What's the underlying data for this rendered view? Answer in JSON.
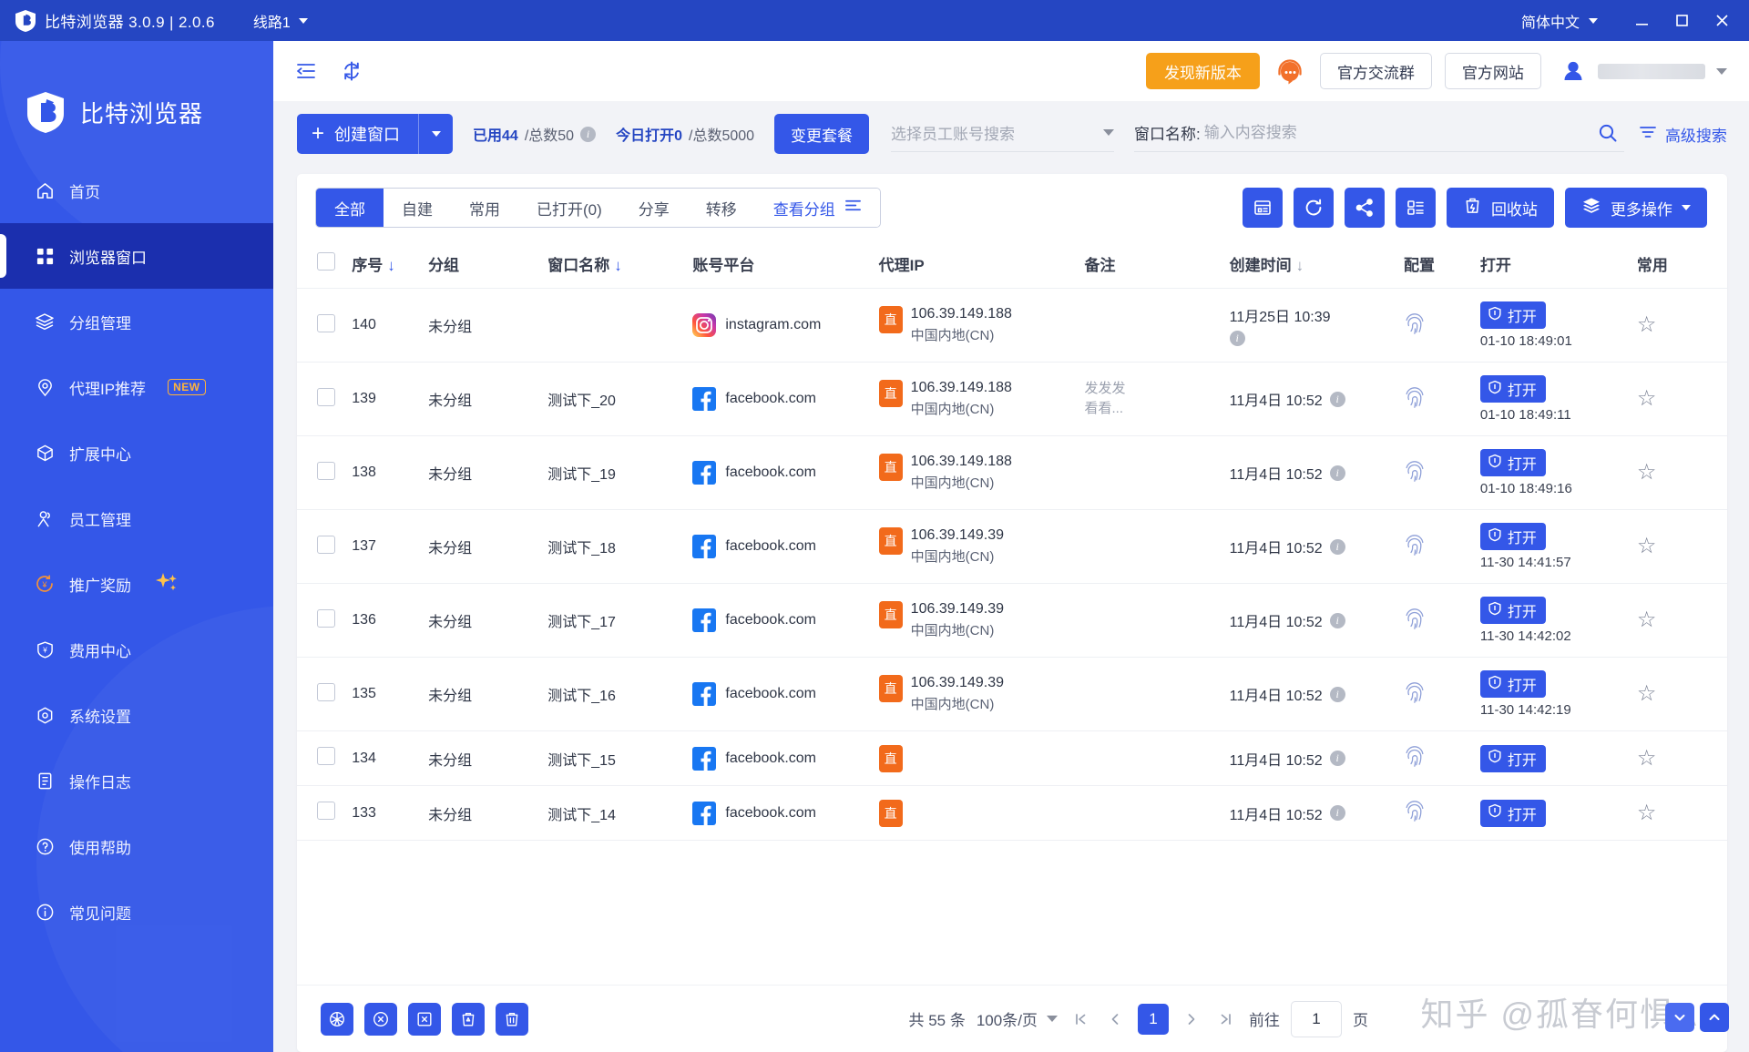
{
  "titlebar": {
    "logo_icon": "shield-b-logo-icon",
    "title": "比特浏览器 3.0.9 | 2.0.6",
    "line_label": "线路1",
    "language": "简体中文",
    "minimize": "_",
    "maximize": "❐",
    "close": "✕"
  },
  "sidebar": {
    "brand": "比特浏览器",
    "items": [
      {
        "label": "首页",
        "icon": "home-icon",
        "active": false
      },
      {
        "label": "浏览器窗口",
        "icon": "grid-windows-icon",
        "active": true
      },
      {
        "label": "分组管理",
        "icon": "layers-icon",
        "active": false
      },
      {
        "label": "代理IP推荐",
        "icon": "location-pin-icon",
        "active": false,
        "badge": "NEW"
      },
      {
        "label": "扩展中心",
        "icon": "cube-icon",
        "active": false
      },
      {
        "label": "员工管理",
        "icon": "user-group-icon",
        "active": false
      },
      {
        "label": "推广奖励",
        "icon": "coin-reward-icon",
        "active": false,
        "sparkle": "✦"
      },
      {
        "label": "费用中心",
        "icon": "shield-yuan-icon",
        "active": false
      },
      {
        "label": "系统设置",
        "icon": "settings-gear-icon",
        "active": false
      },
      {
        "label": "操作日志",
        "icon": "log-book-icon",
        "active": false
      },
      {
        "label": "使用帮助",
        "icon": "question-circle-icon",
        "active": false
      },
      {
        "label": "常见问题",
        "icon": "info-circle-icon",
        "active": false
      }
    ]
  },
  "topbar": {
    "collapse_icon": "collapse-sidebar-icon",
    "refresh_icon": "refresh-icon",
    "new_version_label": "发现新版本",
    "support_icon": "headset-support-icon",
    "official_group_label": "官方交流群",
    "official_site_label": "官方网站",
    "avatar_icon": "user-avatar-icon"
  },
  "actionbar": {
    "create_label": "创建窗口",
    "create_plus": "+",
    "quota_used_prefix": "已用",
    "quota_used": "44",
    "quota_total": "/总数50",
    "today_open_prefix": "今日打开",
    "today_open": "0",
    "today_total": "/总数5000",
    "change_plan_label": "变更套餐",
    "staff_select_placeholder": "选择员工账号搜索",
    "window_name_label": "窗口名称:",
    "window_name_placeholder": "输入内容搜索",
    "window_name_value": "",
    "search_icon": "search-icon",
    "advanced_search_label": "高级搜索"
  },
  "tabs": {
    "items": [
      {
        "label": "全部",
        "active": true
      },
      {
        "label": "自建",
        "active": false
      },
      {
        "label": "常用",
        "active": false
      },
      {
        "label": "已打开(0)",
        "active": false
      },
      {
        "label": "分享",
        "active": false
      },
      {
        "label": "转移",
        "active": false
      },
      {
        "label": "查看分组",
        "active": false,
        "icon": "filter-sort-icon"
      }
    ],
    "actions": [
      {
        "icon": "window-add-icon",
        "label": ""
      },
      {
        "icon": "refresh-circle-icon",
        "label": ""
      },
      {
        "icon": "share-nodes-icon",
        "label": ""
      },
      {
        "icon": "list-detail-icon",
        "label": ""
      },
      {
        "icon": "trash-recycle-icon",
        "label": "回收站"
      },
      {
        "icon": "layers-stack-icon",
        "label": "更多操作"
      }
    ]
  },
  "table": {
    "columns": [
      {
        "key": "chk",
        "label": "",
        "sort": false
      },
      {
        "key": "seq",
        "label": "序号",
        "sort": true,
        "sort_color": "blue"
      },
      {
        "key": "group",
        "label": "分组",
        "sort": false
      },
      {
        "key": "name",
        "label": "窗口名称",
        "sort": true,
        "sort_color": "blue"
      },
      {
        "key": "plat",
        "label": "账号平台",
        "sort": false
      },
      {
        "key": "ip",
        "label": "代理IP",
        "sort": false
      },
      {
        "key": "note",
        "label": "备注",
        "sort": false
      },
      {
        "key": "time",
        "label": "创建时间",
        "sort": true,
        "sort_color": "gray"
      },
      {
        "key": "cfg",
        "label": "配置",
        "sort": false
      },
      {
        "key": "open",
        "label": "打开",
        "sort": false
      },
      {
        "key": "star",
        "label": "常用",
        "sort": false
      }
    ],
    "sort_arrow": "↓",
    "group_default": "未分组",
    "open_label": "打开",
    "rows": [
      {
        "seq": "140",
        "group": "未分组",
        "name": "",
        "platform": "instagram.com",
        "platform_icon": "instagram-icon",
        "ip_tag": "直",
        "ip": "106.39.149.188",
        "ip_region": "中国内地(CN)",
        "note": "",
        "note2": "",
        "time": "11月25日 10:39",
        "time_info": true,
        "time_info_below": true,
        "config_icon": "fingerprint-icon",
        "open_time": "01-10 18:49:01",
        "star": "☆"
      },
      {
        "seq": "139",
        "group": "未分组",
        "name": "测试下_20",
        "platform": "facebook.com",
        "platform_icon": "facebook-icon",
        "ip_tag": "直",
        "ip": "106.39.149.188",
        "ip_region": "中国内地(CN)",
        "note": "发发发",
        "note2": "看看...",
        "time": "11月4日 10:52",
        "time_info": true,
        "time_info_below": false,
        "config_icon": "fingerprint-icon",
        "open_time": "01-10 18:49:11",
        "star": "☆"
      },
      {
        "seq": "138",
        "group": "未分组",
        "name": "测试下_19",
        "platform": "facebook.com",
        "platform_icon": "facebook-icon",
        "ip_tag": "直",
        "ip": "106.39.149.188",
        "ip_region": "中国内地(CN)",
        "note": "",
        "note2": "",
        "time": "11月4日 10:52",
        "time_info": true,
        "time_info_below": false,
        "config_icon": "fingerprint-icon",
        "open_time": "01-10 18:49:16",
        "star": "☆"
      },
      {
        "seq": "137",
        "group": "未分组",
        "name": "测试下_18",
        "platform": "facebook.com",
        "platform_icon": "facebook-icon",
        "ip_tag": "直",
        "ip": "106.39.149.39",
        "ip_region": "中国内地(CN)",
        "note": "",
        "note2": "",
        "time": "11月4日 10:52",
        "time_info": true,
        "time_info_below": false,
        "config_icon": "fingerprint-icon",
        "open_time": "11-30 14:41:57",
        "star": "☆"
      },
      {
        "seq": "136",
        "group": "未分组",
        "name": "测试下_17",
        "platform": "facebook.com",
        "platform_icon": "facebook-icon",
        "ip_tag": "直",
        "ip": "106.39.149.39",
        "ip_region": "中国内地(CN)",
        "note": "",
        "note2": "",
        "time": "11月4日 10:52",
        "time_info": true,
        "time_info_below": false,
        "config_icon": "fingerprint-icon",
        "open_time": "11-30 14:42:02",
        "star": "☆"
      },
      {
        "seq": "135",
        "group": "未分组",
        "name": "测试下_16",
        "platform": "facebook.com",
        "platform_icon": "facebook-icon",
        "ip_tag": "直",
        "ip": "106.39.149.39",
        "ip_region": "中国内地(CN)",
        "note": "",
        "note2": "",
        "time": "11月4日 10:52",
        "time_info": true,
        "time_info_below": false,
        "config_icon": "fingerprint-icon",
        "open_time": "11-30 14:42:19",
        "star": "☆"
      },
      {
        "seq": "134",
        "group": "未分组",
        "name": "测试下_15",
        "platform": "facebook.com",
        "platform_icon": "facebook-icon",
        "ip_tag": "直",
        "ip": "",
        "ip_region": "",
        "note": "",
        "note2": "",
        "time": "11月4日 10:52",
        "time_info": true,
        "time_info_below": false,
        "config_icon": "fingerprint-icon",
        "open_time": "",
        "star": "☆"
      },
      {
        "seq": "133",
        "group": "未分组",
        "name": "测试下_14",
        "platform": "facebook.com",
        "platform_icon": "facebook-icon",
        "ip_tag": "直",
        "ip": "",
        "ip_region": "",
        "note": "",
        "note2": "",
        "time": "11月4日 10:52",
        "time_info": true,
        "time_info_below": false,
        "config_icon": "fingerprint-icon",
        "open_time": "",
        "star": "☆"
      }
    ]
  },
  "footer": {
    "tools": [
      {
        "icon": "batch-open-icon"
      },
      {
        "icon": "batch-close-icon"
      },
      {
        "icon": "batch-cancel-icon"
      },
      {
        "icon": "batch-recycle-icon"
      },
      {
        "icon": "batch-delete-icon"
      }
    ],
    "total_label": "共 55 条",
    "page_size": "100条/页",
    "first_page_icon": "first-page-icon",
    "prev_page_icon": "prev-page-icon",
    "current_page": "1",
    "next_page_icon": "next-page-icon",
    "last_page_icon": "last-page-icon",
    "goto_label": "前往",
    "goto_value": "1",
    "page_unit": "页"
  },
  "watermark": "知乎 @孤眘何惧A",
  "colors": {
    "brand_blue": "#3457e8",
    "title_blue": "#2546c2",
    "active_nav": "#1b2fae",
    "orange": "#f6a01a",
    "ip_orange": "#f26a1b",
    "badge_new": "#ffb43a"
  }
}
